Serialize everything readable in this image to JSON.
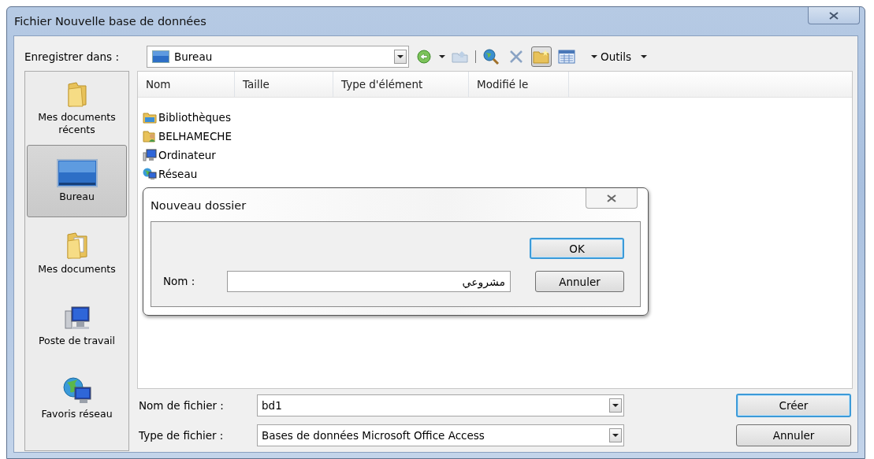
{
  "window": {
    "title": "Fichier Nouvelle base de données"
  },
  "save_in": {
    "label": "Enregistrer dans :",
    "value": "Bureau"
  },
  "toolbar": {
    "items": [
      {
        "kind": "back",
        "pressed": false
      },
      {
        "kind": "up",
        "pressed": false
      },
      {
        "kind": "search",
        "pressed": false
      },
      {
        "kind": "delete",
        "pressed": false
      },
      {
        "kind": "new-folder",
        "pressed": true
      },
      {
        "kind": "views",
        "pressed": false
      }
    ],
    "tools_label": "Outils"
  },
  "places": [
    {
      "label": "Mes documents récents",
      "kind": "recent",
      "selected": false
    },
    {
      "label": "Bureau",
      "kind": "desktop",
      "selected": true
    },
    {
      "label": "Mes documents",
      "kind": "documents",
      "selected": false
    },
    {
      "label": "Poste de travail",
      "kind": "computer",
      "selected": false
    },
    {
      "label": "Favoris réseau",
      "kind": "network",
      "selected": false
    }
  ],
  "file_list": {
    "columns": [
      "Nom",
      "Taille",
      "Type d'élément",
      "Modifié le"
    ],
    "items": [
      {
        "name": "Bibliothèques",
        "kind": "library"
      },
      {
        "name": "BELHAMECHE",
        "kind": "user"
      },
      {
        "name": "Ordinateur",
        "kind": "computer"
      },
      {
        "name": "Réseau",
        "kind": "network"
      }
    ]
  },
  "new_folder_dialog": {
    "title": "Nouveau dossier",
    "name_label": "Nom :",
    "name_value": "مشروعي",
    "buttons": [
      {
        "label": "OK",
        "default": true
      },
      {
        "label": "Annuler",
        "default": false
      }
    ]
  },
  "file_name": {
    "label": "Nom de fichier :",
    "value": "bd1"
  },
  "file_type": {
    "label": "Type de fichier :",
    "value": "Bases de données Microsoft Office Access"
  },
  "buttons": [
    {
      "label": "Créer",
      "default": true
    },
    {
      "label": "Annuler",
      "default": false
    }
  ]
}
